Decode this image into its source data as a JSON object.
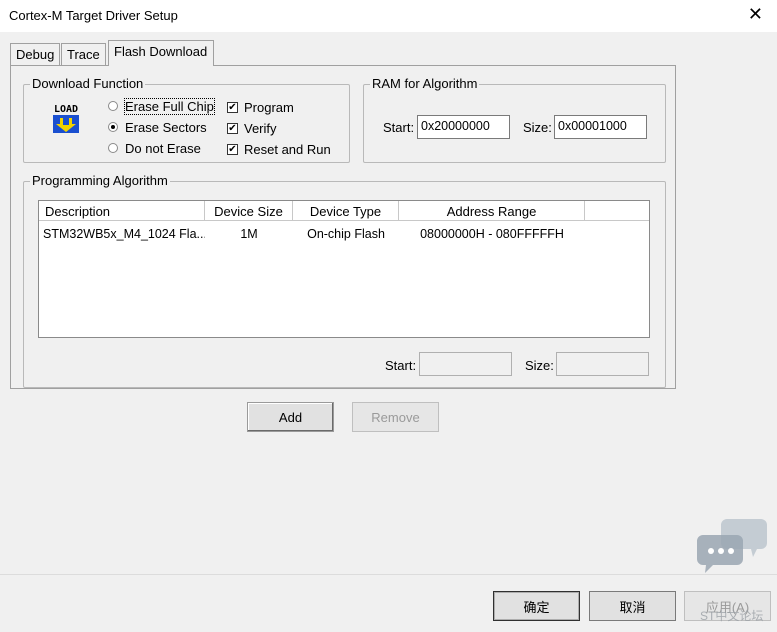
{
  "window": {
    "title": "Cortex-M Target Driver Setup",
    "close_glyph": "✕"
  },
  "tabs": [
    {
      "label": "Debug"
    },
    {
      "label": "Trace"
    },
    {
      "label": "Flash Download"
    }
  ],
  "download_function": {
    "group_label": "Download Function",
    "icon_text": "LOAD",
    "radios": [
      {
        "label": "Erase Full Chip",
        "selected": false
      },
      {
        "label": "Erase Sectors",
        "selected": true
      },
      {
        "label": "Do not Erase",
        "selected": false
      }
    ],
    "checks": [
      {
        "label": "Program",
        "checked": true
      },
      {
        "label": "Verify",
        "checked": true
      },
      {
        "label": "Reset and Run",
        "checked": true
      }
    ]
  },
  "ram_algorithm": {
    "group_label": "RAM for Algorithm",
    "start_label": "Start:",
    "start_value": "0x20000000",
    "size_label": "Size:",
    "size_value": "0x00001000"
  },
  "programming_algorithm": {
    "group_label": "Programming Algorithm",
    "columns": [
      "Description",
      "Device Size",
      "Device Type",
      "Address Range"
    ],
    "rows": [
      {
        "description": "STM32WB5x_M4_1024 Fla...",
        "size": "1M",
        "type": "On-chip Flash",
        "range": "08000000H - 080FFFFFH"
      }
    ],
    "start_label": "Start:",
    "start_value": "",
    "size_label": "Size:",
    "size_value": ""
  },
  "buttons": {
    "add": "Add",
    "remove": "Remove"
  },
  "dialog_buttons": {
    "ok": "确定",
    "cancel": "取消",
    "apply": "应用(A)"
  },
  "watermark_text": "ST中文论坛"
}
